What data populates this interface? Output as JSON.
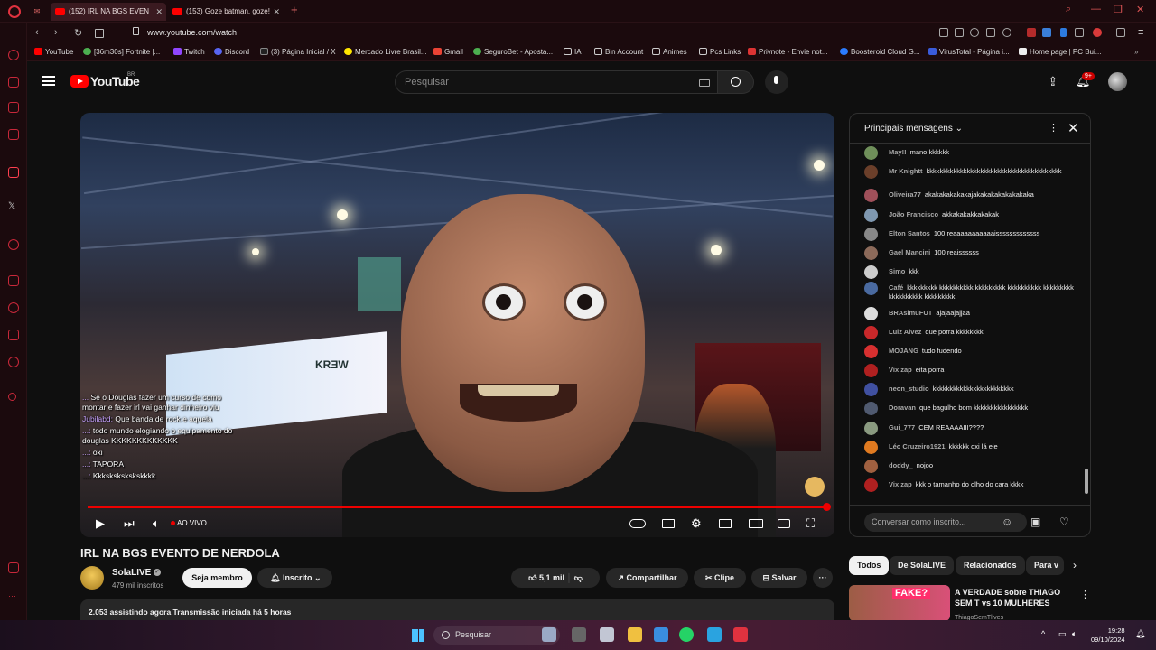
{
  "browser": {
    "tabs": [
      {
        "title": "(152) IRL NA BGS EVEN"
      },
      {
        "title": "(153) Goze batman, goze!"
      }
    ],
    "url": "www.youtube.com/watch",
    "bookmarks": [
      "YouTube",
      "[36m30s] Fortnite |...",
      "Twitch",
      "Discord",
      "(3) Página Inicial / X",
      "Mercado Livre Brasil...",
      "Gmail",
      "SeguroBet - Aposta...",
      "IA",
      "Bin Account",
      "Animes",
      "Pcs Links",
      "Privnote - Envie not...",
      "Boosteroid Cloud G...",
      "VirusTotal - Página i...",
      "Home page | PC Bui..."
    ]
  },
  "youtube": {
    "logo_text": "YouTube",
    "region": "BR",
    "search_placeholder": "Pesquisar",
    "notification_count": "9+"
  },
  "video": {
    "title": "IRL NA BGS EVENTO DE NERDOLA",
    "live_label": "AO VIVO",
    "banner_text": "KRƎW",
    "overlay_chat": [
      {
        "author": "... ",
        "text": "Se o Douglas fazer um curso de como montar e fazer irl vai ganhar dinheiro viu"
      },
      {
        "author": "Jubilabd:",
        "text": "Que banda de rock e aquela"
      },
      {
        "author": "...:",
        "text": "todo mundo elogiando o equipamento do douglas KKKKKKKKKKKKK"
      },
      {
        "author": "...:",
        "text": "oxi"
      },
      {
        "author": "...:",
        "text": "TAPORA"
      },
      {
        "author": "...:",
        "text": "Kkkskskskskskkkk"
      }
    ]
  },
  "channel": {
    "name": "SolaLIVE",
    "subscribers": "479 mil inscritos",
    "member_label": "Seja membro",
    "subscribed_label": "Inscrito"
  },
  "actions": {
    "likes": "5,1 mil",
    "share": "Compartilhar",
    "clip": "Clipe",
    "save": "Salvar"
  },
  "description": {
    "summary": "2.053 assistindo agora  Transmissão iniciada há 5 horas"
  },
  "chat": {
    "title": "Principais mensagens",
    "input_placeholder": "Conversar como inscrito...",
    "messages": [
      {
        "author": "May!!",
        "text": "mano kkkkkk",
        "color": "#6f8f5a"
      },
      {
        "author": "Mr Knightt",
        "text": "kkkkkkkkkkkkkkkkkkkkkkkkkkkkkkkkkkkkkkkk",
        "color": "#6b3f2a"
      },
      {
        "author": "Oliveira77",
        "text": "akakakakakakajakakakakakakakaka",
        "color": "#a0505a"
      },
      {
        "author": "João Francisco",
        "text": "akkakakakkakakak",
        "color": "#7f98b0"
      },
      {
        "author": "Elton Santos",
        "text": "100 reaaaaaaaaaaaisssssssssssss",
        "color": "#888888"
      },
      {
        "author": "Gael Mancini",
        "text": "100 reaissssss",
        "color": "#8c6a5a"
      },
      {
        "author": "Simo",
        "text": "kkk",
        "color": "#cccccc"
      },
      {
        "author": "Café",
        "text": "kkkkkkkkk kkkkkkkkkk kkkkkkkkk kkkkkkkkkk kkkkkkkkk kkkkkkkkkk kkkkkkkkk",
        "color": "#4a6aa0"
      },
      {
        "author": "BRAsimuFUT",
        "text": "ajajaajajjaa",
        "color": "#dddddd"
      },
      {
        "author": "Luiz Alvez",
        "text": "que porra kkkkkkkk",
        "color": "#c8282a"
      },
      {
        "author": "MOJANG",
        "text": "tudo fudendo",
        "color": "#d83030"
      },
      {
        "author": "Vix zap",
        "text": "eita porra",
        "color": "#b02020"
      },
      {
        "author": "neon_studio",
        "text": "kkkkkkkkkkkkkkkkkkkkkkkk",
        "color": "#4050a0"
      },
      {
        "author": "Doravan",
        "text": "que bagulho bom kkkkkkkkkkkkkkkk",
        "color": "#505a70"
      },
      {
        "author": "Gui_777",
        "text": "CEM REAAAAIII????",
        "color": "#8a9a80"
      },
      {
        "author": "Léo Cruzeiro1921",
        "text": "kkkkkk oxi lá ele",
        "color": "#e07a20"
      },
      {
        "author": "doddy_",
        "text": "nojoo",
        "color": "#a06040"
      },
      {
        "author": "Vix zap",
        "text": "kkk o tamanho do olho do cara kkkk",
        "color": "#b02020"
      }
    ]
  },
  "chips": [
    "Todos",
    "De SolaLIVE",
    "Relacionados",
    "Para v"
  ],
  "related": {
    "title": "A VERDADE sobre THIAGO SEM T vs 10 MULHERES",
    "channel": "ThiagoSemTlives",
    "thumb_label": "FAKE?"
  },
  "taskbar": {
    "search_placeholder": "Pesquisar",
    "time": "19:28",
    "date": "09/10/2024"
  }
}
